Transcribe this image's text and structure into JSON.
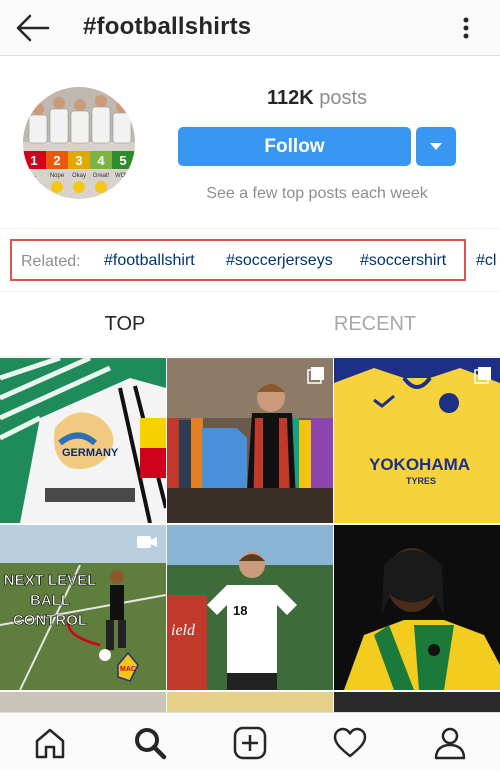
{
  "topbar": {
    "title": "#footballshirts",
    "back_icon": "back-arrow-icon",
    "more_icon": "more-vertical-icon"
  },
  "header": {
    "posts_count": "112K",
    "posts_label": "posts",
    "follow_label": "Follow",
    "subtext": "See a few top posts each week",
    "avatar_numbers": [
      "1",
      "2",
      "3",
      "4",
      "5"
    ],
    "avatar_words": [
      "...",
      "Nope",
      "Okay",
      "Great!",
      "WOW"
    ]
  },
  "related": {
    "label": "Related:",
    "tags": [
      "#footballshirt",
      "#soccerjerseys",
      "#soccershirt",
      "#cl"
    ]
  },
  "tabs": {
    "top": "TOP",
    "recent": "RECENT"
  },
  "posts": {
    "p1_text": "GERMANY",
    "p3_text": "YOKOHAMA",
    "p3_sub": "TYRES",
    "p4_line1": "NEXT LEVEL",
    "p4_line2": "BALL",
    "p4_line3": "CONTROL",
    "p4_badge": "MAC",
    "p5_number": "18",
    "p5_bg": "ield"
  },
  "colors": {
    "accent": "#3897f0",
    "highlight_border": "#d9534f",
    "link": "#003569"
  },
  "nav": [
    "home-icon",
    "search-icon",
    "add-post-icon",
    "heart-icon",
    "profile-icon"
  ]
}
